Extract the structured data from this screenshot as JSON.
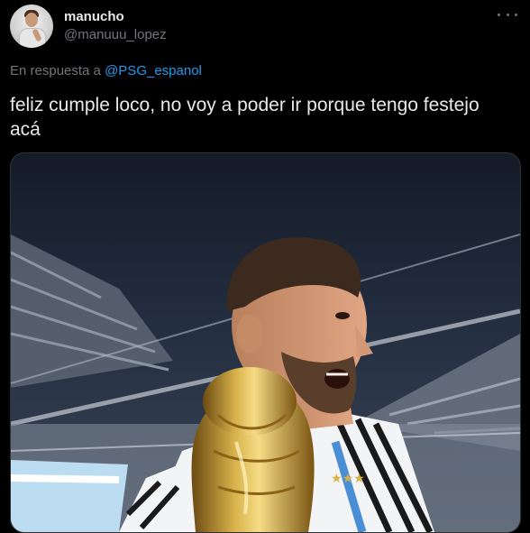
{
  "tweet": {
    "display_name": "manucho",
    "handle": "@manuuu_lopez",
    "reply_prefix": "En respuesta a",
    "reply_to": "@PSG_espanol",
    "text": "feliz cumple loco, no voy a poder ir porque tengo festejo acá"
  },
  "icons": {
    "more": "more-horizontal-icon"
  },
  "colors": {
    "background": "#000000",
    "text": "#e7e9ea",
    "muted": "#71767b",
    "link": "#1d9bf0"
  }
}
